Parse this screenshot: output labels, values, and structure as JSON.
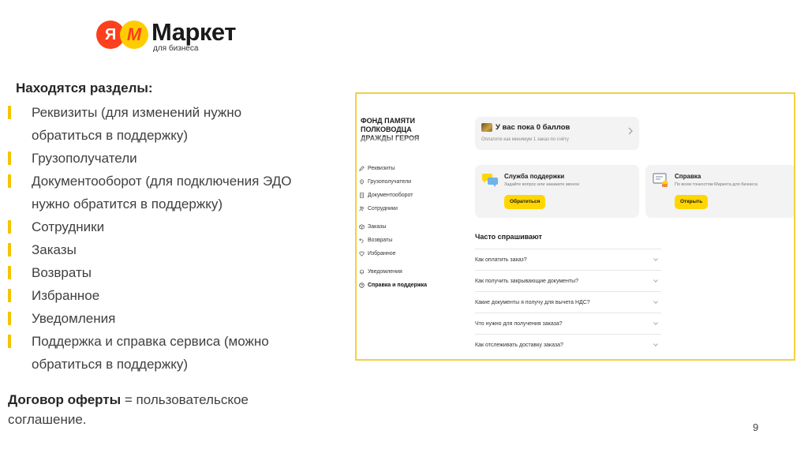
{
  "logo": {
    "ya": "Я",
    "m": "М",
    "word": "Маркет",
    "sub": "для бизнеса"
  },
  "sections_title": "Находятся разделы:",
  "bullets": [
    [
      "Реквизиты (для изменений нужно",
      "обратиться в поддержку)"
    ],
    [
      "Грузополучатели"
    ],
    [
      "Документооборот (для подключения ЭДО",
      "нужно обратится в поддержку)"
    ],
    [
      "Сотрудники"
    ],
    [
      "Заказы"
    ],
    [
      "Возвраты"
    ],
    [
      "Избранное"
    ],
    [
      "Уведомления"
    ],
    [
      "Поддержка и справка сервиса (можно",
      "обратиться в поддержку)"
    ]
  ],
  "offer": {
    "bold": "Договор оферты",
    "rest": " = пользовательское",
    "line2": "соглашение."
  },
  "page_number": "9",
  "screenshot": {
    "org_lines": [
      "ФОНД ПАМЯТИ",
      "ПОЛКОВОДЦА",
      "ДРАЖДЫ ГЕРОЯ"
    ],
    "nav": [
      {
        "label": "Реквизиты",
        "icon": "pencil-icon"
      },
      {
        "label": "Грузополучатели",
        "icon": "location-pin-icon"
      },
      {
        "label": "Документооборот",
        "icon": "document-icon"
      },
      {
        "label": "Сотрудники",
        "icon": "people-icon"
      },
      {
        "label": "Заказы",
        "icon": "box-icon"
      },
      {
        "label": "Возвраты",
        "icon": "return-icon"
      },
      {
        "label": "Избранное",
        "icon": "heart-icon"
      },
      {
        "label": "Уведомления",
        "icon": "bell-icon"
      },
      {
        "label": "Справка и поддержка",
        "icon": "help-icon"
      }
    ],
    "points": {
      "title": "У вас пока 0 баллов",
      "subtitle": "Оплатите как минимум 1 заказ по счёту"
    },
    "support": {
      "title": "Служба поддержки",
      "subtitle": "Задайте вопрос или закажите звонок",
      "button": "Обратиться"
    },
    "help": {
      "title": "Справка",
      "subtitle": "По всем тонкостям Маркета для бизнеса",
      "button": "Открыть"
    },
    "faq_title": "Часто спрашивают",
    "faq": [
      "Как оплатить заказ?",
      "Как получить закрывающие документы?",
      "Какие документы я получу для вычета НДС?",
      "Что нужно для получения заказа?",
      "Как отслеживать доставку заказа?"
    ]
  },
  "colors": {
    "accent_yellow": "#f4c400",
    "button_yellow": "#ffd600",
    "brand_red": "#fc3f1d",
    "card_bg": "#f3f3f3"
  }
}
